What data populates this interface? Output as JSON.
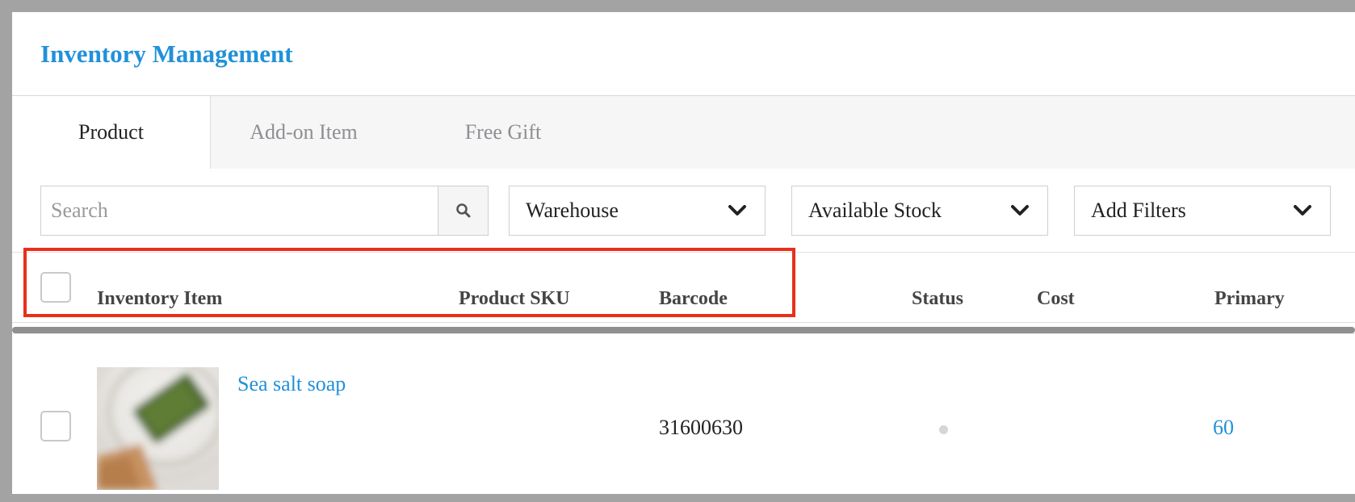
{
  "header": {
    "title": "Inventory Management"
  },
  "tabs": [
    {
      "label": "Product",
      "active": true
    },
    {
      "label": "Add-on Item",
      "active": false
    },
    {
      "label": "Free Gift",
      "active": false
    }
  ],
  "search": {
    "placeholder": "Search",
    "value": ""
  },
  "filters": [
    {
      "label": "Warehouse"
    },
    {
      "label": "Available Stock"
    },
    {
      "label": "Add Filters"
    }
  ],
  "table": {
    "columns": [
      "Inventory Item",
      "Product SKU",
      "Barcode",
      "Status",
      "Cost",
      "Primary"
    ],
    "rows": [
      {
        "name": "Sea salt soap",
        "sku": "",
        "barcode": "31600630",
        "status": "",
        "cost": "",
        "primary": "60",
        "checked": false
      }
    ]
  },
  "colors": {
    "accent": "#2191d9",
    "highlight": "#e8301c"
  },
  "icons": [
    "search-icon",
    "chevron-down-icon",
    "product-thumbnail"
  ]
}
